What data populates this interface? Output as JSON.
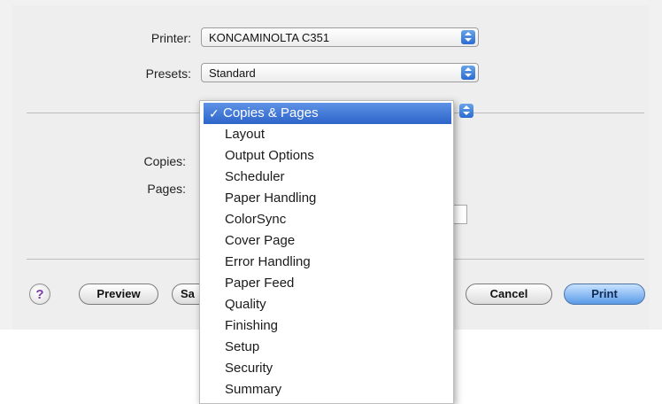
{
  "printer": {
    "label": "Printer:",
    "value": "KONCAMINOLTA C351"
  },
  "presets": {
    "label": "Presets:",
    "value": "Standard"
  },
  "copies": {
    "label": "Copies:"
  },
  "pages": {
    "label": "Pages:"
  },
  "menu": {
    "items": [
      "Copies & Pages",
      "Layout",
      "Output Options",
      "Scheduler",
      "Paper Handling",
      "ColorSync",
      "Cover Page",
      "Error Handling",
      "Paper Feed",
      "Quality",
      "Finishing",
      "Setup",
      "Security",
      "Summary"
    ],
    "selected_index": 0
  },
  "buttons": {
    "help": "?",
    "preview": "Preview",
    "save_partial": "Sa",
    "cancel": "Cancel",
    "print": "Print"
  },
  "icons": {
    "checkmark": "✓",
    "popup_arrows": "popup-arrows-icon"
  },
  "colors": {
    "accent": "#2c64c9",
    "help_icon": "#7a3aa8"
  }
}
